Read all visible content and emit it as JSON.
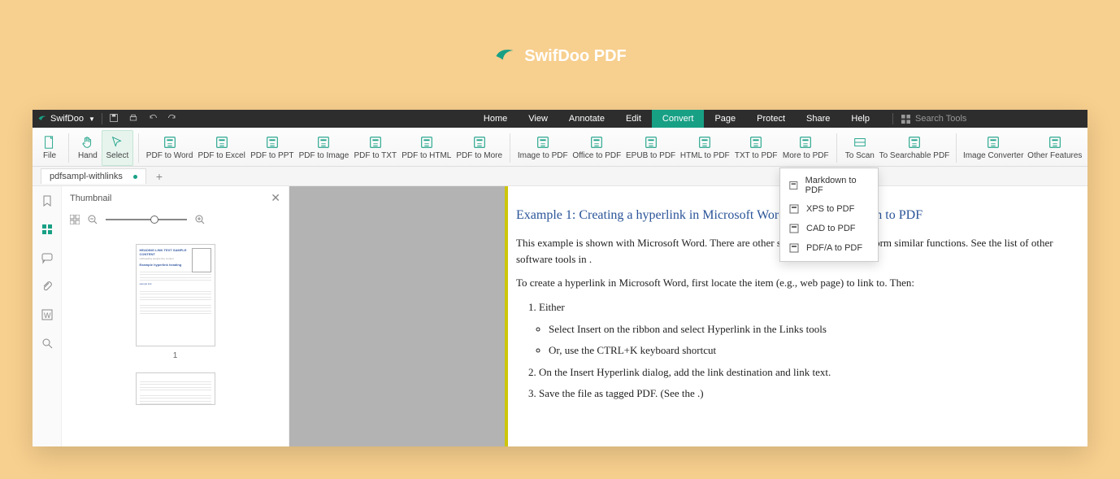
{
  "brand": {
    "title": "SwifDoo PDF"
  },
  "titlebar": {
    "app_name": "SwifDoo",
    "search_placeholder": "Search Tools"
  },
  "menus": [
    "Home",
    "View",
    "Annotate",
    "Edit",
    "Convert",
    "Page",
    "Protect",
    "Share",
    "Help"
  ],
  "menus_active_index": 4,
  "ribbon": {
    "groups": [
      [
        "File"
      ],
      [
        "Hand",
        "Select"
      ],
      [
        "PDF to Word",
        "PDF to Excel",
        "PDF to PPT",
        "PDF to Image",
        "PDF to TXT",
        "PDF to HTML",
        "PDF to More"
      ],
      [
        "Image to PDF",
        "Office to PDF",
        "EPUB to PDF",
        "HTML to PDF",
        "TXT to PDF",
        "More to PDF"
      ],
      [
        "To Scan",
        "To Searchable PDF"
      ],
      [
        "Image Converter",
        "Other Features"
      ]
    ],
    "selected": "Select"
  },
  "tab": {
    "name": "pdfsampl-withlinks"
  },
  "thumbnail": {
    "title": "Thumbnail",
    "page_num": "1"
  },
  "dropdown": [
    "Markdown to PDF",
    "XPS to PDF",
    "CAD to PDF",
    "PDF/A to PDF"
  ],
  "doc": {
    "heading": "Example 1: Creating a hyperlink in Microsoft Word before conversion to PDF",
    "p1": "This example is shown with Microsoft Word. There are other software tools that perform similar functions. See the list of other software tools in .",
    "p2": "To create a hyperlink in Microsoft Word, first locate the item (e.g., web page) to link to. Then:",
    "li1": "Either",
    "sub1": "Select Insert on the ribbon and select Hyperlink in the Links tools",
    "sub2": "Or, use the CTRL+K keyboard shortcut",
    "li2": "On the Insert Hyperlink dialog, add the link destination and link text.",
    "li3": "Save the file as tagged PDF. (See the .)"
  }
}
